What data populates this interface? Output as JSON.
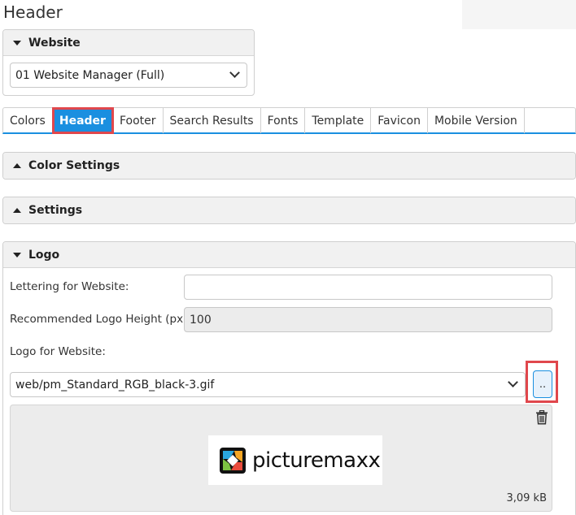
{
  "page": {
    "title": "Header"
  },
  "website_panel": {
    "heading": "Website",
    "selected": "01 Website Manager (Full)"
  },
  "tabs": [
    {
      "label": "Colors",
      "active": false
    },
    {
      "label": "Header",
      "active": true
    },
    {
      "label": "Footer",
      "active": false
    },
    {
      "label": "Search Results",
      "active": false
    },
    {
      "label": "Fonts",
      "active": false
    },
    {
      "label": "Template",
      "active": false
    },
    {
      "label": "Favicon",
      "active": false
    },
    {
      "label": "Mobile Version",
      "active": false
    }
  ],
  "sections": {
    "color_settings": "Color Settings",
    "settings": "Settings",
    "logo": "Logo"
  },
  "logo_form": {
    "lettering_label": "Lettering for Website:",
    "lettering_value": "",
    "height_label": "Recommended Logo Height (px):",
    "height_value": "100",
    "logo_label": "Logo for Website:",
    "logo_file": "web/pm_Standard_RGB_black-3.gif",
    "browse_label": "..",
    "preview_logo_text": "picturemaxx",
    "file_size": "3,09 kB"
  },
  "colors": {
    "accent": "#1a8fe0",
    "highlight": "#e0474c"
  }
}
